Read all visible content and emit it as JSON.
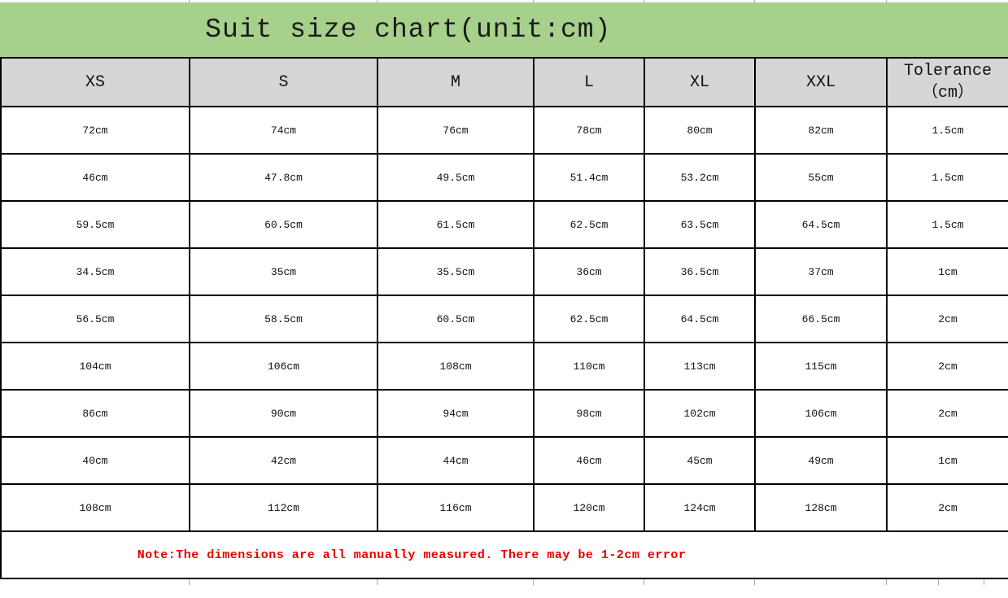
{
  "title": "Suit size chart(unit:cm)",
  "header": {
    "tolerance_line1": "Tolerance",
    "tolerance_line2": "（cm）"
  },
  "note": "Note:The dimensions are all manually measured. There may be 1-2cm error",
  "colors": {
    "title_bg": "#a6d08c",
    "header_bg": "#d6d6d6",
    "note_color": "#e60000",
    "border": "#000000"
  },
  "chart_data": {
    "type": "table",
    "title": "Suit size chart(unit:cm)",
    "columns": [
      "XS",
      "S",
      "M",
      "L",
      "XL",
      "XXL",
      "Tolerance（cm）"
    ],
    "rows": [
      [
        "72cm",
        "74cm",
        "76cm",
        "78cm",
        "80cm",
        "82cm",
        "1.5cm"
      ],
      [
        "46cm",
        "47.8cm",
        "49.5cm",
        "51.4cm",
        "53.2cm",
        "55cm",
        "1.5cm"
      ],
      [
        "59.5cm",
        "60.5cm",
        "61.5cm",
        "62.5cm",
        "63.5cm",
        "64.5cm",
        "1.5cm"
      ],
      [
        "34.5cm",
        "35cm",
        "35.5cm",
        "36cm",
        "36.5cm",
        "37cm",
        "1cm"
      ],
      [
        "56.5cm",
        "58.5cm",
        "60.5cm",
        "62.5cm",
        "64.5cm",
        "66.5cm",
        "2cm"
      ],
      [
        "104cm",
        "106cm",
        "108cm",
        "110cm",
        "113cm",
        "115cm",
        "2cm"
      ],
      [
        "86cm",
        "90cm",
        "94cm",
        "98cm",
        "102cm",
        "106cm",
        "2cm"
      ],
      [
        "40cm",
        "42cm",
        "44cm",
        "46cm",
        "45cm",
        "49cm",
        "1cm"
      ],
      [
        "108cm",
        "112cm",
        "116cm",
        "120cm",
        "124cm",
        "128cm",
        "2cm"
      ]
    ],
    "note": "Note:The dimensions are all manually measured. There may be 1-2cm error"
  }
}
